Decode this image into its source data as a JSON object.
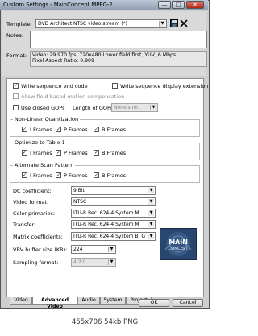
{
  "window": {
    "title": "Custom Settings - MainConcept MPEG-2",
    "minimize_glyph": "—",
    "maximize_glyph": "□",
    "close_glyph": "✕"
  },
  "template": {
    "label": "Template:",
    "value": "DVD Architect NTSC video stream (*)",
    "save_icon": "save-icon",
    "delete_icon": "delete-icon"
  },
  "notes": {
    "label": "Notes:",
    "value": ""
  },
  "format": {
    "label": "Format:",
    "line1": "Video: 29.970 fps, 720x480 Lower field first, YUV, 6 Mbps",
    "line2": "Pixel Aspect Ratio: 0.909"
  },
  "options": {
    "write_seq_end_code": {
      "label": "Write sequence end code",
      "checked": true
    },
    "write_seq_display_ext": {
      "label": "Write sequence display extension",
      "checked": false
    },
    "allow_field_based": {
      "label": "Allow field-based motion compensation",
      "checked": false
    },
    "use_closed_gops": {
      "label": "Use closed GOPs",
      "checked": false
    },
    "length_of_gops": {
      "label": "Length of GOPs:",
      "value": "None short"
    }
  },
  "nonlinear_quant": {
    "title": "Non-Linear Quantization",
    "i_frames": "I Frames",
    "p_frames": "P Frames",
    "b_frames": "B Frames"
  },
  "optimize_table": {
    "title": "Optimize to Table 1",
    "i_frames": "I Frames",
    "p_frames": "P Frames",
    "b_frames": "B Frames"
  },
  "alt_scan": {
    "title": "Alternate Scan Pattern",
    "i_frames": "I Frames",
    "p_frames": "P Frames",
    "b_frames": "B Frames"
  },
  "dc_coefficient": {
    "label": "DC coefficient:",
    "value": "9 Bit"
  },
  "video_format": {
    "label": "Video format:",
    "value": "NTSC"
  },
  "color_primaries": {
    "label": "Color primaries:",
    "value": "ITU-R Rec. 624-4 System M"
  },
  "transfer": {
    "label": "Transfer:",
    "value": "ITU-R Rec. 624-4 System M"
  },
  "matrix_coefficients": {
    "label": "Matrix coefficients:",
    "value": "ITU-R Rec. 624-4 System B, G"
  },
  "vbv_buffer": {
    "label": "VBV buffer size (KB):",
    "value": "224"
  },
  "sampling_format": {
    "label": "Sampling format:",
    "value": "4:2:0"
  },
  "logo": {
    "line1": "MAIN",
    "line2": "CONCEPT"
  },
  "tabs": [
    "Video",
    "Advanced Video",
    "Audio",
    "System",
    "Project"
  ],
  "buttons": {
    "ok": "OK",
    "cancel": "Cancel"
  },
  "footer": {
    "caption": "455x706  54kb  PNG"
  }
}
